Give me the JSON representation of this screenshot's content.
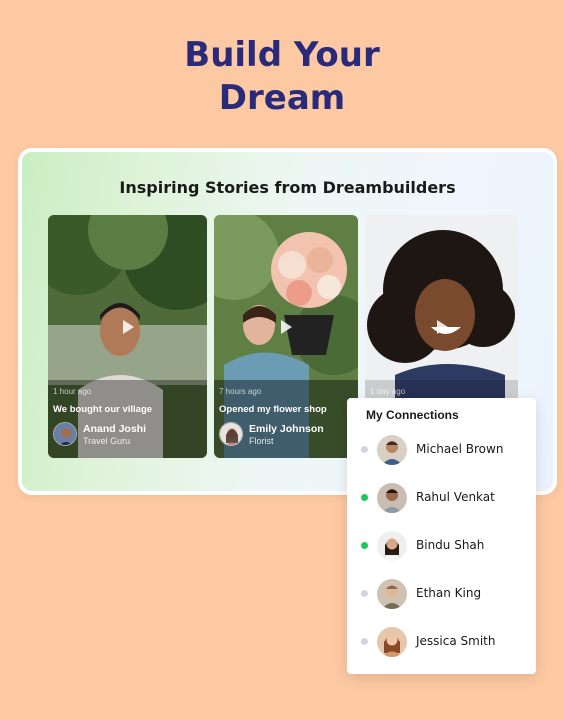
{
  "hero": {
    "title_line1": "Build Your",
    "title_line2": "Dream"
  },
  "stories": {
    "title": "Inspiring Stories from Dreambuilders",
    "items": [
      {
        "time": "1 hour ago",
        "headline": "We bought our village",
        "author": "Anand Joshi",
        "role": "Travel Guru"
      },
      {
        "time": "7 hours ago",
        "headline": "Opened my flower shop",
        "author": "Emily Johnson",
        "role": "Florist"
      },
      {
        "time": "1 day ago"
      }
    ]
  },
  "connections": {
    "title": "My Connections",
    "items": [
      {
        "name": "Michael Brown",
        "online": false
      },
      {
        "name": "Rahul Venkat",
        "online": true
      },
      {
        "name": "Bindu Shah",
        "online": true
      },
      {
        "name": "Ethan King",
        "online": false
      },
      {
        "name": "Jessica Smith",
        "online": false
      }
    ]
  },
  "colors": {
    "background": "#fdc9a3",
    "title": "#2a2a7a",
    "online": "#22c55e",
    "offline": "#d1d5db"
  }
}
